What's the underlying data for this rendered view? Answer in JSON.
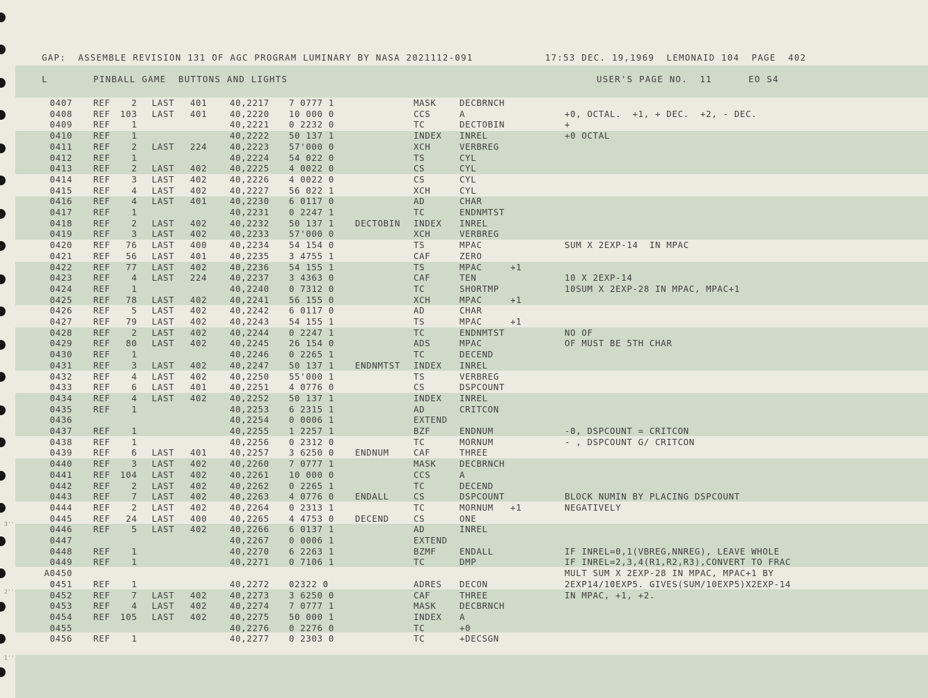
{
  "header": {
    "line1_left": "GAP:  ASSEMBLE REVISION 131 OF AGC PROGRAM LUMINARY BY NASA 2021112-091",
    "line1_right": "17:53 DEC. 19,1969  LEMONAID 104  PAGE  402",
    "line2_col": "L",
    "line2_title": "PINBALL GAME  BUTTONS AND LIGHTS",
    "line2_right": "USER'S PAGE NO.  11      EO S4"
  },
  "margin_marks": [
    "3''",
    "2''",
    "1''"
  ],
  "rows": [
    {
      "line": "0407",
      "ref": "REF",
      "refnum": "2",
      "last": "LAST",
      "lastnum": "401",
      "addr": "40,2217",
      "code": "7 0777 1",
      "label": "",
      "op": "MASK",
      "operand": "DECBRNCH",
      "comment": ""
    },
    {
      "line": "0408",
      "ref": "REF",
      "refnum": "103",
      "last": "LAST",
      "lastnum": "401",
      "addr": "40,2220",
      "code": "10 000 0",
      "label": "",
      "op": "CCS",
      "operand": "A",
      "comment": "+0, OCTAL.  +1, + DEC.  +2, - DEC."
    },
    {
      "line": "0409",
      "ref": "REF",
      "refnum": "1",
      "last": "",
      "lastnum": "",
      "addr": "40,2221",
      "code": "0 2232 0",
      "label": "",
      "op": "TC",
      "operand": "DECTOBIN",
      "comment": "+"
    },
    {
      "line": "0410",
      "ref": "REF",
      "refnum": "1",
      "last": "",
      "lastnum": "",
      "addr": "40,2222",
      "code": "50 137 1",
      "label": "",
      "op": "INDEX",
      "operand": "INREL",
      "comment": "+0 OCTAL"
    },
    {
      "line": "0411",
      "ref": "REF",
      "refnum": "2",
      "last": "LAST",
      "lastnum": "224",
      "addr": "40,2223",
      "code": "57'000 0",
      "label": "",
      "op": "XCH",
      "operand": "VERBREG",
      "comment": ""
    },
    {
      "line": "0412",
      "ref": "REF",
      "refnum": "1",
      "last": "",
      "lastnum": "",
      "addr": "40,2224",
      "code": "54 022 0",
      "label": "",
      "op": "TS",
      "operand": "CYL",
      "comment": ""
    },
    {
      "line": "0413",
      "ref": "REF",
      "refnum": "2",
      "last": "LAST",
      "lastnum": "402",
      "addr": "40,2225",
      "code": "4 0022 0",
      "label": "",
      "op": "CS",
      "operand": "CYL",
      "comment": ""
    },
    {
      "line": "0414",
      "ref": "REF",
      "refnum": "3",
      "last": "LAST",
      "lastnum": "402",
      "addr": "40,2226",
      "code": "4 0022 0",
      "label": "",
      "op": "CS",
      "operand": "CYL",
      "comment": ""
    },
    {
      "line": "0415",
      "ref": "REF",
      "refnum": "4",
      "last": "LAST",
      "lastnum": "402",
      "addr": "40,2227",
      "code": "56 022 1",
      "label": "",
      "op": "XCH",
      "operand": "CYL",
      "comment": ""
    },
    {
      "line": "0416",
      "ref": "REF",
      "refnum": "4",
      "last": "LAST",
      "lastnum": "401",
      "addr": "40,2230",
      "code": "6 0117 0",
      "label": "",
      "op": "AD",
      "operand": "CHAR",
      "comment": ""
    },
    {
      "line": "0417",
      "ref": "REF",
      "refnum": "1",
      "last": "",
      "lastnum": "",
      "addr": "40,2231",
      "code": "0 2247 1",
      "label": "",
      "op": "TC",
      "operand": "ENDNMTST",
      "comment": ""
    },
    {
      "line": "0418",
      "ref": "REF",
      "refnum": "2",
      "last": "LAST",
      "lastnum": "402",
      "addr": "40,2232",
      "code": "50 137 1",
      "label": "DECTOBIN",
      "op": "INDEX",
      "operand": "INREL",
      "comment": ""
    },
    {
      "line": "0419",
      "ref": "REF",
      "refnum": "3",
      "last": "LAST",
      "lastnum": "402",
      "addr": "40,2233",
      "code": "57'000 0",
      "label": "",
      "op": "XCH",
      "operand": "VERBREG",
      "comment": ""
    },
    {
      "line": "0420",
      "ref": "REF",
      "refnum": "76",
      "last": "LAST",
      "lastnum": "400",
      "addr": "40,2234",
      "code": "54 154 0",
      "label": "",
      "op": "TS",
      "operand": "MPAC",
      "comment": "SUM X 2EXP-14  IN MPAC"
    },
    {
      "line": "0421",
      "ref": "REF",
      "refnum": "56",
      "last": "LAST",
      "lastnum": "401",
      "addr": "40,2235",
      "code": "3 4755 1",
      "label": "",
      "op": "CAF",
      "operand": "ZERO",
      "comment": ""
    },
    {
      "line": "0422",
      "ref": "REF",
      "refnum": "77",
      "last": "LAST",
      "lastnum": "402",
      "addr": "40,2236",
      "code": "54 155 1",
      "label": "",
      "op": "TS",
      "operand": "MPAC     +1",
      "comment": ""
    },
    {
      "line": "0423",
      "ref": "REF",
      "refnum": "4",
      "last": "LAST",
      "lastnum": "224",
      "addr": "40,2237",
      "code": "3 4363 0",
      "label": "",
      "op": "CAF",
      "operand": "TEN",
      "comment": "10 X 2EXP-14"
    },
    {
      "line": "0424",
      "ref": "REF",
      "refnum": "1",
      "last": "",
      "lastnum": "",
      "addr": "40,2240",
      "code": "0 7312 0",
      "label": "",
      "op": "TC",
      "operand": "SHORTMP",
      "comment": "10SUM X 2EXP-28 IN MPAC, MPAC+1"
    },
    {
      "line": "0425",
      "ref": "REF",
      "refnum": "78",
      "last": "LAST",
      "lastnum": "402",
      "addr": "40,2241",
      "code": "56 155 0",
      "label": "",
      "op": "XCH",
      "operand": "MPAC     +1",
      "comment": ""
    },
    {
      "line": "0426",
      "ref": "REF",
      "refnum": "5",
      "last": "LAST",
      "lastnum": "402",
      "addr": "40,2242",
      "code": "6 0117 0",
      "label": "",
      "op": "AD",
      "operand": "CHAR",
      "comment": ""
    },
    {
      "line": "0427",
      "ref": "REF",
      "refnum": "79",
      "last": "LAST",
      "lastnum": "402",
      "addr": "40,2243",
      "code": "54 155 1",
      "label": "",
      "op": "TS",
      "operand": "MPAC     +1",
      "comment": ""
    },
    {
      "line": "0428",
      "ref": "REF",
      "refnum": "2",
      "last": "LAST",
      "lastnum": "402",
      "addr": "40,2244",
      "code": "0 2247 1",
      "label": "",
      "op": "TC",
      "operand": "ENDNMTST",
      "comment": "NO OF"
    },
    {
      "line": "0429",
      "ref": "REF",
      "refnum": "80",
      "last": "LAST",
      "lastnum": "402",
      "addr": "40,2245",
      "code": "26 154 0",
      "label": "",
      "op": "ADS",
      "operand": "MPAC",
      "comment": "OF MUST BE 5TH CHAR"
    },
    {
      "line": "0430",
      "ref": "REF",
      "refnum": "1",
      "last": "",
      "lastnum": "",
      "addr": "40,2246",
      "code": "0 2265 1",
      "label": "",
      "op": "TC",
      "operand": "DECEND",
      "comment": ""
    },
    {
      "line": "0431",
      "ref": "REF",
      "refnum": "3",
      "last": "LAST",
      "lastnum": "402",
      "addr": "40,2247",
      "code": "50 137 1",
      "label": "ENDNMTST",
      "op": "INDEX",
      "operand": "INREL",
      "comment": ""
    },
    {
      "line": "0432",
      "ref": "REF",
      "refnum": "4",
      "last": "LAST",
      "lastnum": "402",
      "addr": "40,2250",
      "code": "55'000 1",
      "label": "",
      "op": "TS",
      "operand": "VERBREG",
      "comment": ""
    },
    {
      "line": "0433",
      "ref": "REF",
      "refnum": "6",
      "last": "LAST",
      "lastnum": "401",
      "addr": "40,2251",
      "code": "4 0776 0",
      "label": "",
      "op": "CS",
      "operand": "DSPCOUNT",
      "comment": ""
    },
    {
      "line": "0434",
      "ref": "REF",
      "refnum": "4",
      "last": "LAST",
      "lastnum": "402",
      "addr": "40,2252",
      "code": "50 137 1",
      "label": "",
      "op": "INDEX",
      "operand": "INREL",
      "comment": ""
    },
    {
      "line": "0435",
      "ref": "REF",
      "refnum": "1",
      "last": "",
      "lastnum": "",
      "addr": "40,2253",
      "code": "6 2315 1",
      "label": "",
      "op": "AD",
      "operand": "CRITCON",
      "comment": ""
    },
    {
      "line": "0436",
      "ref": "",
      "refnum": "",
      "last": "",
      "lastnum": "",
      "addr": "40,2254",
      "code": "0 0006 1",
      "label": "",
      "op": "EXTEND",
      "operand": "",
      "comment": ""
    },
    {
      "line": "0437",
      "ref": "REF",
      "refnum": "1",
      "last": "",
      "lastnum": "",
      "addr": "40,2255",
      "code": "1 2257 1",
      "label": "",
      "op": "BZF",
      "operand": "ENDNUM",
      "comment": "-0, DSPCOUNT = CRITCON"
    },
    {
      "line": "0438",
      "ref": "REF",
      "refnum": "1",
      "last": "",
      "lastnum": "",
      "addr": "40,2256",
      "code": "0 2312 0",
      "label": "",
      "op": "TC",
      "operand": "MORNUM",
      "comment": "- , DSPCOUNT G/ CRITCON"
    },
    {
      "line": "0439",
      "ref": "REF",
      "refnum": "6",
      "last": "LAST",
      "lastnum": "401",
      "addr": "40,2257",
      "code": "3 6250 0",
      "label": "ENDNUM",
      "op": "CAF",
      "operand": "THREE",
      "comment": ""
    },
    {
      "line": "0440",
      "ref": "REF",
      "refnum": "3",
      "last": "LAST",
      "lastnum": "402",
      "addr": "40,2260",
      "code": "7 0777 1",
      "label": "",
      "op": "MASK",
      "operand": "DECBRNCH",
      "comment": ""
    },
    {
      "line": "0441",
      "ref": "REF",
      "refnum": "104",
      "last": "LAST",
      "lastnum": "402",
      "addr": "40,2261",
      "code": "10 000 0",
      "label": "",
      "op": "CCS",
      "operand": "A",
      "comment": ""
    },
    {
      "line": "0442",
      "ref": "REF",
      "refnum": "2",
      "last": "LAST",
      "lastnum": "402",
      "addr": "40,2262",
      "code": "0 2265 1",
      "label": "",
      "op": "TC",
      "operand": "DECEND",
      "comment": ""
    },
    {
      "line": "0443",
      "ref": "REF",
      "refnum": "7",
      "last": "LAST",
      "lastnum": "402",
      "addr": "40,2263",
      "code": "4 0776 0",
      "label": "ENDALL",
      "op": "CS",
      "operand": "DSPCOUNT",
      "comment": "BLOCK NUMIN BY PLACING DSPCOUNT"
    },
    {
      "line": "0444",
      "ref": "REF",
      "refnum": "2",
      "last": "LAST",
      "lastnum": "402",
      "addr": "40,2264",
      "code": "0 2313 1",
      "label": "",
      "op": "TC",
      "operand": "MORNUM   +1",
      "comment": "NEGATIVELY"
    },
    {
      "line": "0445",
      "ref": "REF",
      "refnum": "24",
      "last": "LAST",
      "lastnum": "400",
      "addr": "40,2265",
      "code": "4 4753 0",
      "label": "DECEND",
      "op": "CS",
      "operand": "ONE",
      "comment": ""
    },
    {
      "line": "0446",
      "ref": "REF",
      "refnum": "5",
      "last": "LAST",
      "lastnum": "402",
      "addr": "40,2266",
      "code": "6 0137 1",
      "label": "",
      "op": "AD",
      "operand": "INREL",
      "comment": ""
    },
    {
      "line": "0447",
      "ref": "",
      "refnum": "",
      "last": "",
      "lastnum": "",
      "addr": "40,2267",
      "code": "0 0006 1",
      "label": "",
      "op": "EXTEND",
      "operand": "",
      "comment": ""
    },
    {
      "line": "0448",
      "ref": "REF",
      "refnum": "1",
      "last": "",
      "lastnum": "",
      "addr": "40,2270",
      "code": "6 2263 1",
      "label": "",
      "op": "BZMF",
      "operand": "ENDALL",
      "comment": "IF INREL=0,1(VBREG,NNREG), LEAVE WHOLE"
    },
    {
      "line": "0449",
      "ref": "REF",
      "refnum": "1",
      "last": "",
      "lastnum": "",
      "addr": "40,2271",
      "code": "0 7106 1",
      "label": "",
      "op": "TC",
      "operand": "DMP",
      "comment": "IF INREL=2,3,4(R1,R2,R3),CONVERT TO FRAC"
    },
    {
      "line": "A0450",
      "ref": "",
      "refnum": "",
      "last": "",
      "lastnum": "",
      "addr": "",
      "code": "",
      "label": "",
      "op": "",
      "operand": "",
      "comment": "MULT SUM X 2EXP-28 IN MPAC, MPAC+1 BY"
    },
    {
      "line": "0451",
      "ref": "REF",
      "refnum": "1",
      "last": "",
      "lastnum": "",
      "addr": "40,2272",
      "code": "02322 0",
      "label": "",
      "op": "ADRES",
      "operand": "DECON",
      "comment": "2EXP14/10EXP5. GIVES(SUM/10EXP5)X2EXP-14"
    },
    {
      "line": "0452",
      "ref": "REF",
      "refnum": "7",
      "last": "LAST",
      "lastnum": "402",
      "addr": "40,2273",
      "code": "3 6250 0",
      "label": "",
      "op": "CAF",
      "operand": "THREE",
      "comment": "IN MPAC, +1, +2."
    },
    {
      "line": "0453",
      "ref": "REF",
      "refnum": "4",
      "last": "LAST",
      "lastnum": "402",
      "addr": "40,2274",
      "code": "7 0777 1",
      "label": "",
      "op": "MASK",
      "operand": "DECBRNCH",
      "comment": ""
    },
    {
      "line": "0454",
      "ref": "REF",
      "refnum": "105",
      "last": "LAST",
      "lastnum": "402",
      "addr": "40,2275",
      "code": "50 000 1",
      "label": "",
      "op": "INDEX",
      "operand": "A",
      "comment": ""
    },
    {
      "line": "0455",
      "ref": "",
      "refnum": "",
      "last": "",
      "lastnum": "",
      "addr": "40,2276",
      "code": "0 2276 0",
      "label": "",
      "op": "TC",
      "operand": "+0",
      "comment": ""
    },
    {
      "line": "0456",
      "ref": "REF",
      "refnum": "1",
      "last": "",
      "lastnum": "",
      "addr": "40,2277",
      "code": "0 2303 0",
      "label": "",
      "op": "TC",
      "operand": "+DECSGN",
      "comment": ""
    }
  ]
}
